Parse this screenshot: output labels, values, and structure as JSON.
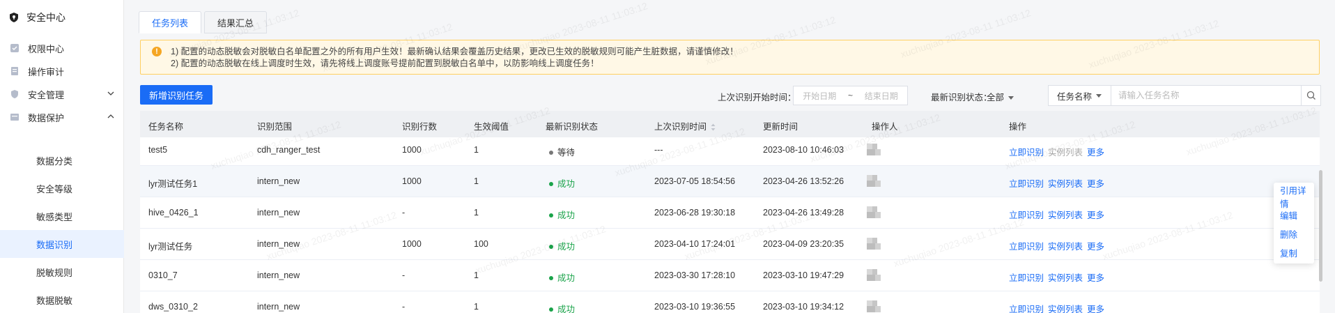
{
  "sidebar": {
    "title": "安全中心",
    "items": [
      {
        "label": "权限中心"
      },
      {
        "label": "操作审计"
      },
      {
        "label": "安全管理"
      },
      {
        "label": "数据保护"
      }
    ],
    "sub_items": [
      {
        "label": "数据分类"
      },
      {
        "label": "安全等级"
      },
      {
        "label": "敏感类型"
      },
      {
        "label": "数据识别"
      },
      {
        "label": "脱敏规则"
      },
      {
        "label": "数据脱敏"
      }
    ]
  },
  "tabs": [
    {
      "label": "任务列表",
      "active": true
    },
    {
      "label": "结果汇总",
      "active": false
    }
  ],
  "notice": {
    "line1": "1) 配置的动态脱敏会对脱敏白名单配置之外的所有用户生效！最新确认结果会覆盖历史结果，更改已生效的脱敏规则可能产生脏数据，请谨慎修改！",
    "line2": "2) 配置的动态脱敏在线上调度时生效，请先将线上调度账号提前配置到脱敏白名单中，以防影响线上调度任务！"
  },
  "toolbar": {
    "new_task": "新增识别任务",
    "last_time_label": "上次识别开始时间：",
    "start_placeholder": "开始日期",
    "range_sep": "~",
    "end_placeholder": "结束日期",
    "status_label": "最新识别状态：",
    "status_value": "全部",
    "name_select": "任务名称",
    "search_placeholder": "请输入任务名称"
  },
  "table": {
    "headers": [
      "任务名称",
      "识别范围",
      "识别行数",
      "生效阈值",
      "最新识别状态",
      "上次识别时间",
      "更新时间",
      "操作人",
      "操作"
    ],
    "rows": [
      {
        "name": "test5",
        "scope": "cdh_ranger_test",
        "rows": "1000",
        "threshold": "1",
        "status": "等待",
        "status_type": "wait",
        "last_time": "---",
        "updated": "2023-08-10 10:46:03"
      },
      {
        "name": "lyr测试任务1",
        "scope": "intern_new",
        "rows": "1000",
        "threshold": "1",
        "status": "成功",
        "status_type": "ok",
        "last_time": "2023-07-05 18:54:56",
        "updated": "2023-04-26 13:52:26"
      },
      {
        "name": "hive_0426_1",
        "scope": "intern_new",
        "rows": "-",
        "threshold": "1",
        "status": "成功",
        "status_type": "ok",
        "last_time": "2023-06-28 19:30:18",
        "updated": "2023-04-26 13:49:28"
      },
      {
        "name": "lyr测试任务",
        "scope": "intern_new",
        "rows": "1000",
        "threshold": "100",
        "status": "成功",
        "status_type": "ok",
        "last_time": "2023-04-10 17:24:01",
        "updated": "2023-04-09 23:20:35"
      },
      {
        "name": "0310_7",
        "scope": "intern_new",
        "rows": "-",
        "threshold": "1",
        "status": "成功",
        "status_type": "ok",
        "last_time": "2023-03-30 17:28:10",
        "updated": "2023-03-10 19:47:29"
      },
      {
        "name": "dws_0310_2",
        "scope": "intern_new",
        "rows": "-",
        "threshold": "1",
        "status": "成功",
        "status_type": "ok",
        "last_time": "2023-03-10 19:36:55",
        "updated": "2023-03-10 19:34:12"
      }
    ],
    "ops": {
      "identify": "立即识别",
      "instances": "实例列表",
      "more": "更多"
    }
  },
  "dropdown": [
    "引用详情",
    "编辑",
    "删除",
    "复制"
  ],
  "watermark": "xuchuqiao 2023-08-11 11:03:12",
  "colors": {
    "accent": "#1a6cf6",
    "success": "#1aa34a",
    "warning": "#f5a623",
    "wait": "#777777"
  }
}
